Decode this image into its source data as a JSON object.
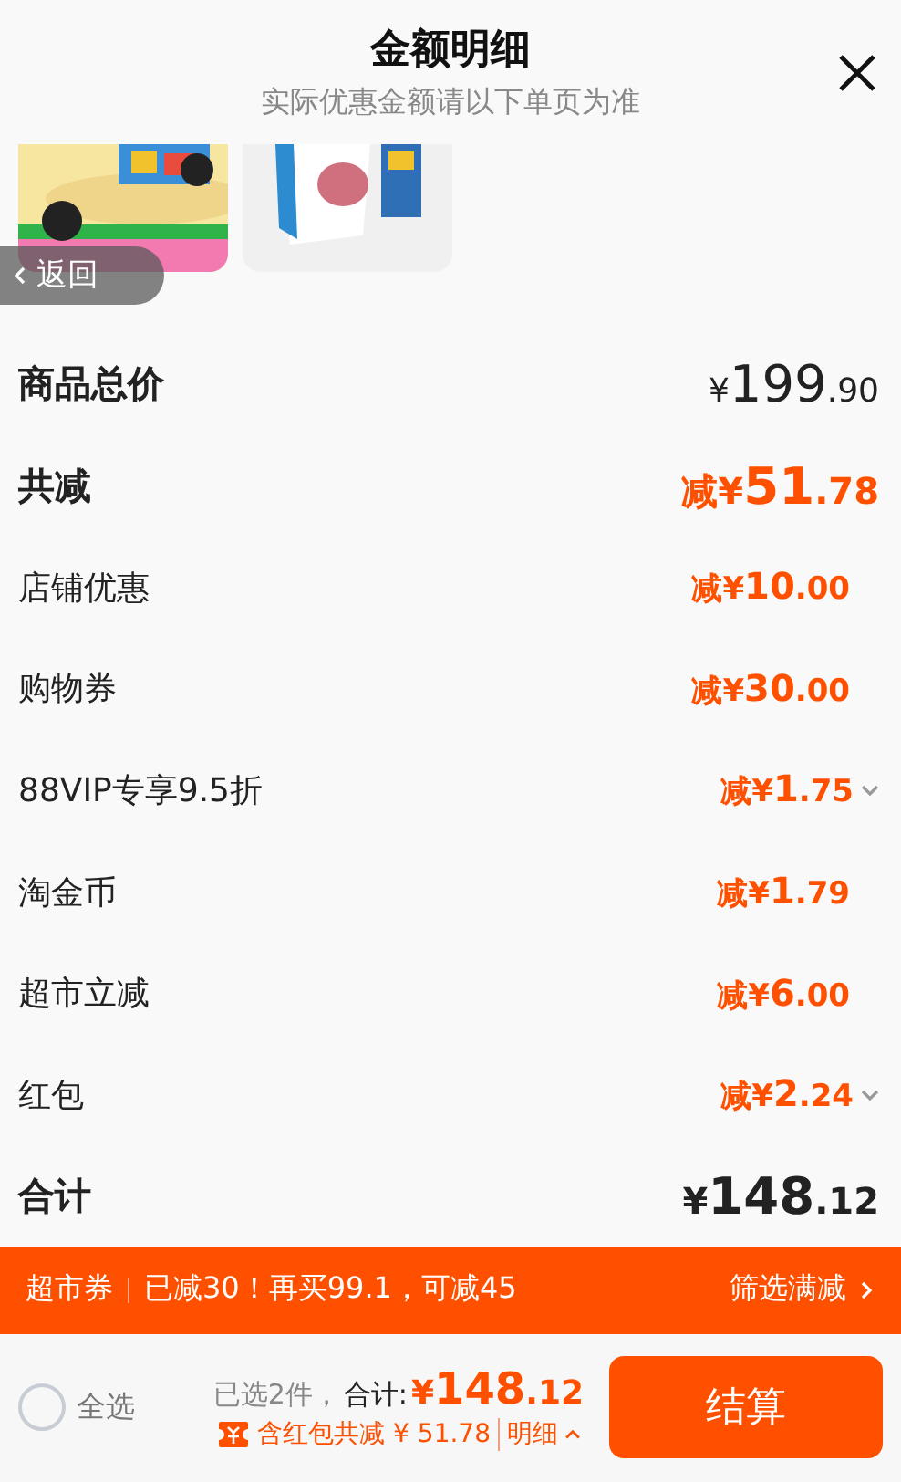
{
  "header": {
    "title": "金额明细",
    "subtitle": "实际优惠金额请以下单页为准"
  },
  "back_button": {
    "label": "返回"
  },
  "rows": [
    {
      "label": "商品总价",
      "amount": "¥199.90",
      "kind": "price",
      "expandable": false
    },
    {
      "label": "共减",
      "amount": "减¥51.78",
      "kind": "reduction",
      "expandable": false
    },
    {
      "label": "店铺优惠",
      "amount": "减¥10.00",
      "kind": "item",
      "expandable": false
    },
    {
      "label": "购物券",
      "amount": "减¥30.00",
      "kind": "item",
      "expandable": false
    },
    {
      "label": "88VIP专享9.5折",
      "amount": "减¥1.75",
      "kind": "item",
      "expandable": true
    },
    {
      "label": "淘金币",
      "amount": "减¥1.79",
      "kind": "item",
      "expandable": false
    },
    {
      "label": "超市立减",
      "amount": "减¥6.00",
      "kind": "item",
      "expandable": false
    },
    {
      "label": "红包",
      "amount": "减¥2.24",
      "kind": "item",
      "expandable": true
    },
    {
      "label": "合计",
      "amount": "¥148.12",
      "kind": "total",
      "expandable": false
    }
  ],
  "promo_bar": {
    "tag": "超市券",
    "message": "已减30！再买99.1，可减45",
    "action": "筛选满减"
  },
  "checkout": {
    "select_all": {
      "label": "全选",
      "checked": false
    },
    "selected_count": "已选2件，",
    "total_label": "合计:",
    "total": "¥148.12",
    "discount_note": "含红包共减 ¥ 51.78",
    "detail_link": "明细",
    "button": "结算"
  }
}
